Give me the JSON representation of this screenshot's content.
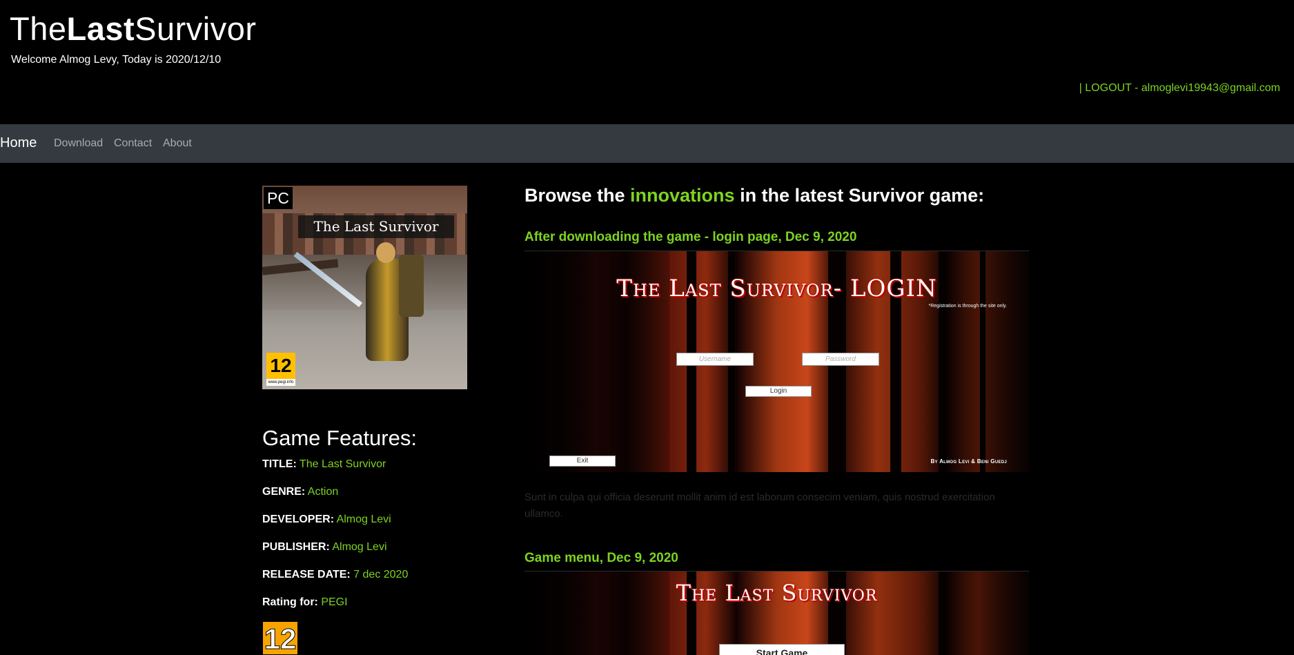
{
  "header": {
    "logo_prefix": "The",
    "logo_bold": "Last",
    "logo_suffix": "Survivor",
    "welcome": "Welcome Almog Levy, Today is 2020/12/10",
    "logout": "| LOGOUT - almoglevi19943@gmail.com"
  },
  "nav": {
    "brand": "Home",
    "links": [
      "Download",
      "Contact",
      "About"
    ]
  },
  "cover": {
    "platform": "PC",
    "title": "The Last Survivor",
    "rating": "12",
    "rating_site": "www.pegi.info"
  },
  "features": {
    "heading": "Game Features:",
    "items": [
      {
        "label": "TITLE:",
        "value": "The Last Survivor"
      },
      {
        "label": "GENRE:",
        "value": "Action"
      },
      {
        "label": "DEVELOPER:",
        "value": "Almog Levi"
      },
      {
        "label": "PUBLISHER:",
        "value": "Almog Levi"
      },
      {
        "label": "RELEASE DATE:",
        "value": "7 dec 2020"
      },
      {
        "label": "Rating for:",
        "value": "PEGI"
      }
    ],
    "pegi_badge": "12"
  },
  "main": {
    "title_prefix": "Browse the ",
    "title_highlight": "innovations",
    "title_suffix": " in the latest Survivor game:",
    "sections": [
      {
        "title": "After downloading the game - login page, Dec 9, 2020",
        "screen": {
          "heading": "The Last Survivor- LOGIN",
          "note": "*Registration is through the site only.",
          "username_placeholder": "Username",
          "password_placeholder": "Password",
          "login_label": "Login",
          "exit_label": "Exit",
          "credit": "By Almog Levi & Beni Guedj"
        },
        "caption": "Sunt in culpa qui officia deserunt mollit anim id est laborum consecim veniam, quis nostrud exercitation ullamco."
      },
      {
        "title": "Game menu, Dec 9, 2020",
        "screen": {
          "heading": "The Last Survivor",
          "start_label": "Start Game"
        }
      }
    ]
  },
  "colors": {
    "accent": "#7ed321",
    "navbar": "#343a40",
    "background": "#000000"
  }
}
